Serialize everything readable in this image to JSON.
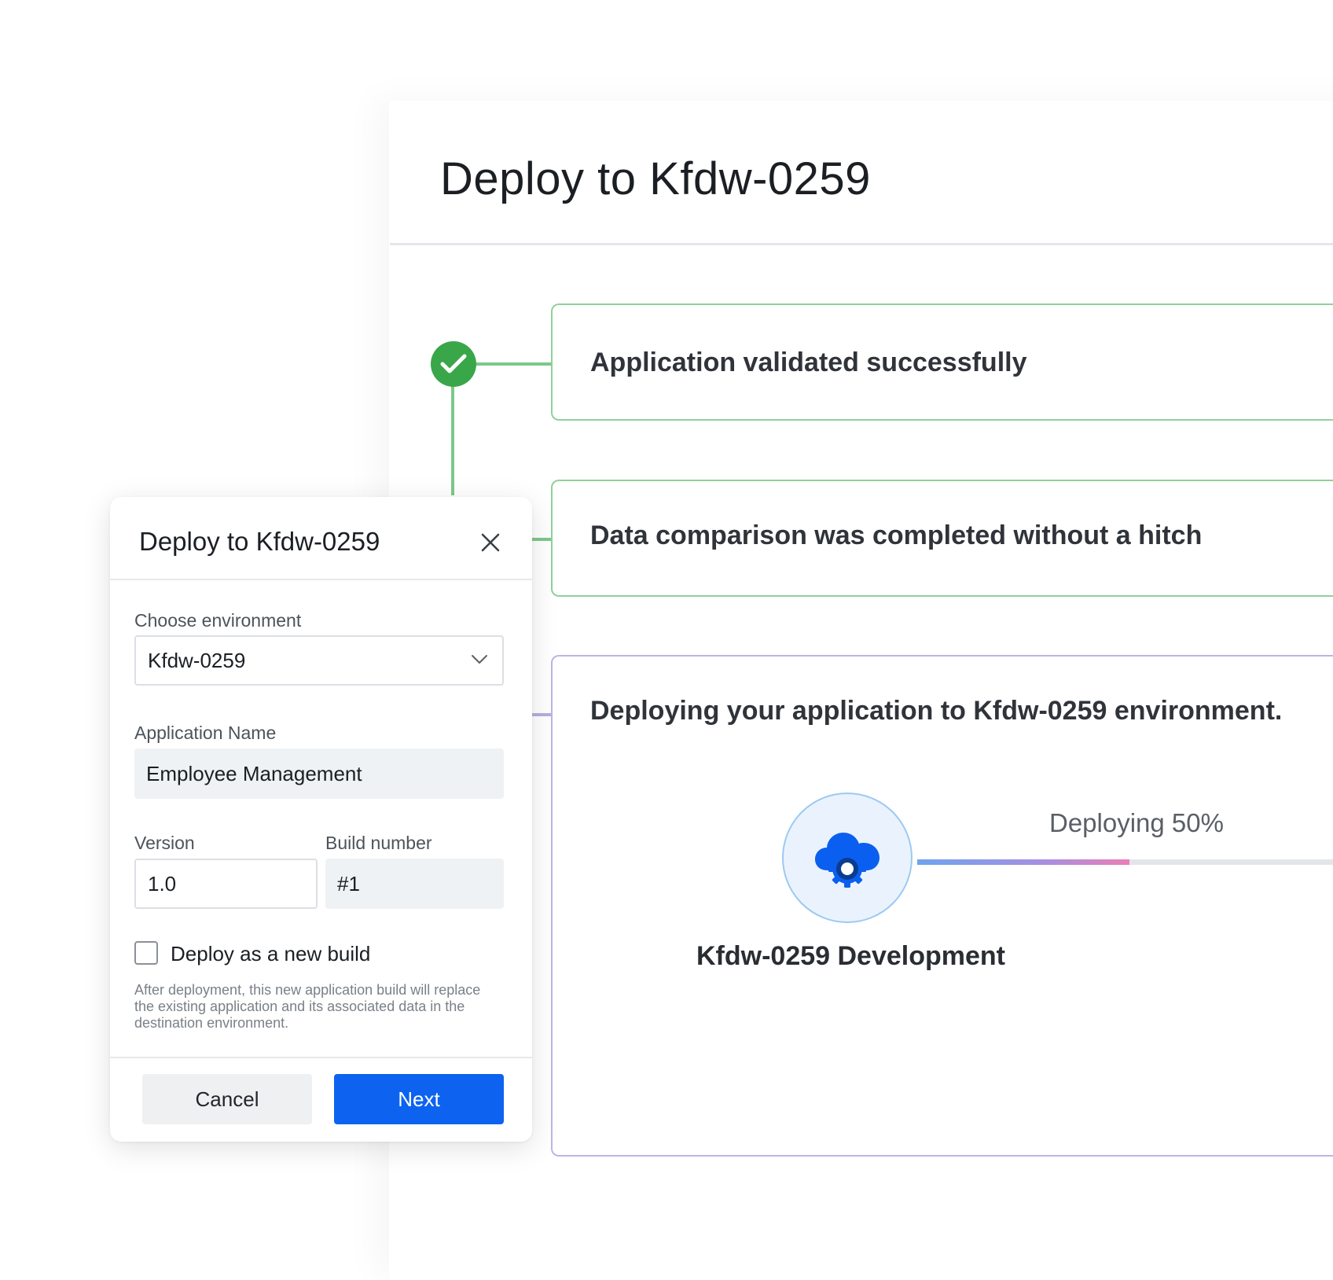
{
  "page": {
    "title": "Deploy to Kfdw-0259"
  },
  "timeline": {
    "steps": [
      {
        "label": "Application validated successfully",
        "status": "complete"
      },
      {
        "label": "Data comparison was completed without a hitch",
        "status": "complete"
      },
      {
        "label": "Deploying your application to Kfdw-0259 environment.",
        "status": "in-progress"
      }
    ],
    "progress": {
      "label": "Deploying 50%",
      "value": 0.5
    },
    "environment_label": "Kfdw-0259 Development",
    "icons": {
      "complete": "check-icon",
      "deploy": "cloud-gear-icon"
    }
  },
  "modal": {
    "title": "Deploy to Kfdw-0259",
    "environment": {
      "label": "Choose environment",
      "value": "Kfdw-0259"
    },
    "application_name": {
      "label": "Application Name",
      "value": "Employee Management"
    },
    "version": {
      "label": "Version",
      "value": "1.0"
    },
    "build_number": {
      "label": "Build number",
      "value": "#1"
    },
    "new_build": {
      "label": "Deploy as a new build",
      "checked": false
    },
    "helper_text": "After deployment, this new application build will replace the existing application and its associated data in the destination environment.",
    "buttons": {
      "cancel": "Cancel",
      "next": "Next"
    }
  },
  "colors": {
    "success": "#3aa64a",
    "success_line": "#7cc98a",
    "in_progress_line": "#bdb5e6",
    "primary": "#0d63f0",
    "cloud": "#0b5ff0"
  }
}
